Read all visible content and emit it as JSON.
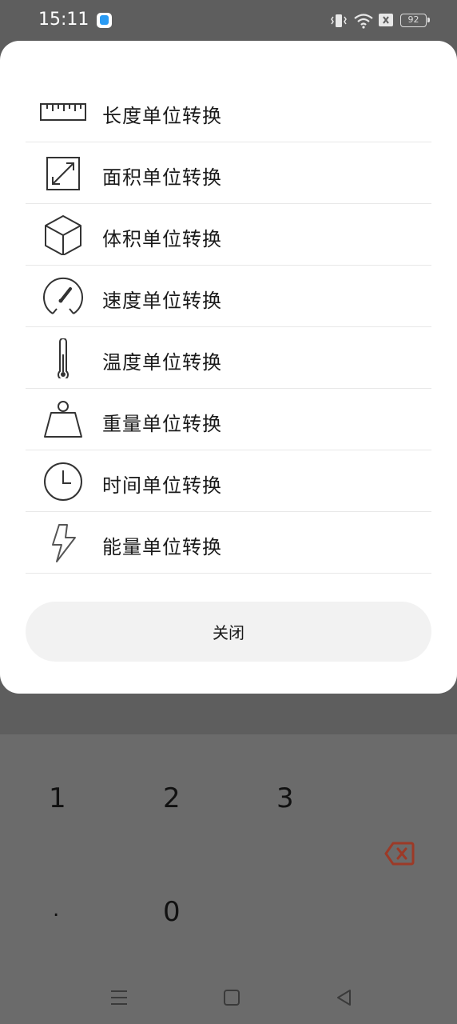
{
  "status_bar": {
    "time": "15:11",
    "battery": "92",
    "icons": [
      "app-notification-icon",
      "vibrate-icon",
      "wifi-icon",
      "no-sim-icon",
      "battery-icon"
    ]
  },
  "dialog": {
    "items": [
      {
        "label": "长度单位转换",
        "icon": "ruler-icon"
      },
      {
        "label": "面积单位转换",
        "icon": "area-expand-icon"
      },
      {
        "label": "体积单位转换",
        "icon": "cube-icon"
      },
      {
        "label": "速度单位转换",
        "icon": "speedometer-icon"
      },
      {
        "label": "温度单位转换",
        "icon": "thermometer-icon"
      },
      {
        "label": "重量单位转换",
        "icon": "weight-icon"
      },
      {
        "label": "时间单位转换",
        "icon": "clock-icon"
      },
      {
        "label": "能量单位转换",
        "icon": "lightning-icon"
      }
    ],
    "close_label": "关闭"
  },
  "keypad": {
    "keys": [
      "1",
      "2",
      "3",
      ".",
      "0"
    ],
    "delete_icon": "backspace-icon"
  },
  "nav_bar": {
    "icons": [
      "menu-icon",
      "home-icon",
      "back-icon"
    ]
  },
  "colors": {
    "sheet": "#ffffff",
    "scrim": "#5e5e5e",
    "close_button": "#f2f2f2",
    "delete_accent": "#9c3a27"
  }
}
